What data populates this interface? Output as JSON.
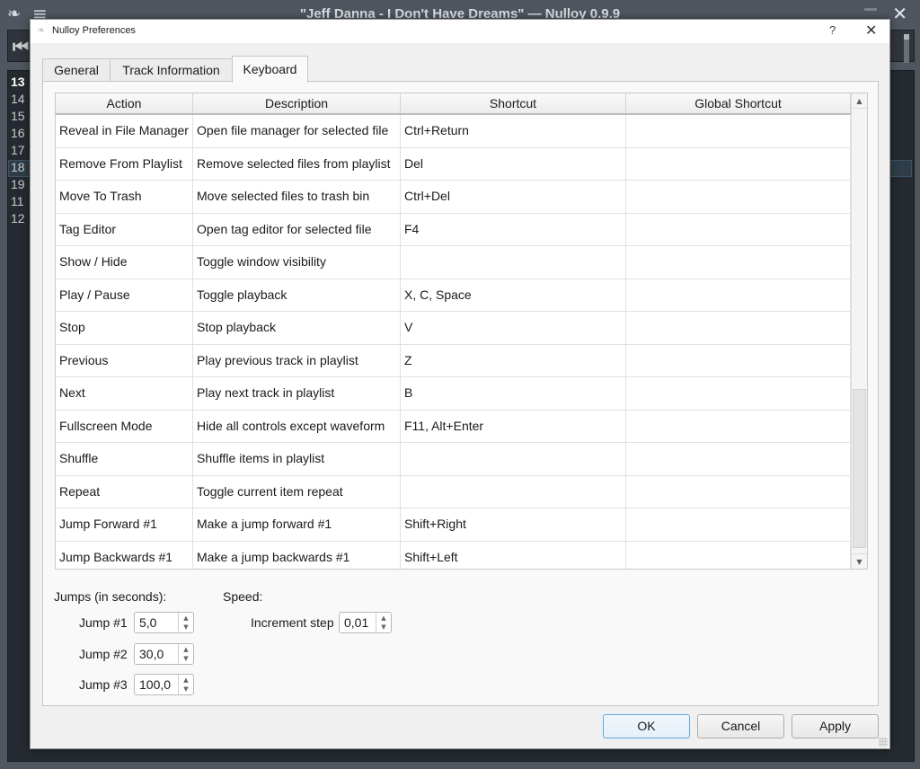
{
  "main_window": {
    "title": "\"Jeff Danna - I Don't Have Dreams\" — Nulloy 0.9.9",
    "playlist_numbers": [
      "13",
      "14",
      "15",
      "16",
      "17",
      "18",
      "19",
      "11",
      "12"
    ],
    "current_number": "13",
    "selected_number": "18"
  },
  "dialog": {
    "title": "Nulloy Preferences",
    "help_label": "?",
    "close_label": "✕",
    "tabs": [
      {
        "label": "General",
        "active": false
      },
      {
        "label": "Track Information",
        "active": false
      },
      {
        "label": "Keyboard",
        "active": true
      }
    ],
    "table": {
      "headers": [
        "Action",
        "Description",
        "Shortcut",
        "Global Shortcut"
      ],
      "rows": [
        {
          "action": "Reveal in File Manager",
          "description": "Open file manager for selected file",
          "shortcut": "Ctrl+Return",
          "global": ""
        },
        {
          "action": "Remove From Playlist",
          "description": "Remove selected files from playlist",
          "shortcut": "Del",
          "global": ""
        },
        {
          "action": "Move To Trash",
          "description": "Move selected files to trash bin",
          "shortcut": "Ctrl+Del",
          "global": ""
        },
        {
          "action": "Tag Editor",
          "description": "Open tag editor for selected file",
          "shortcut": "F4",
          "global": ""
        },
        {
          "action": "Show / Hide",
          "description": "Toggle window visibility",
          "shortcut": "",
          "global": ""
        },
        {
          "action": "Play / Pause",
          "description": "Toggle playback",
          "shortcut": "X, C, Space",
          "global": ""
        },
        {
          "action": "Stop",
          "description": "Stop playback",
          "shortcut": "V",
          "global": ""
        },
        {
          "action": "Previous",
          "description": "Play previous track in playlist",
          "shortcut": "Z",
          "global": ""
        },
        {
          "action": "Next",
          "description": "Play next track in playlist",
          "shortcut": "B",
          "global": ""
        },
        {
          "action": "Fullscreen Mode",
          "description": "Hide all controls except waveform",
          "shortcut": "F11, Alt+Enter",
          "global": ""
        },
        {
          "action": "Shuffle",
          "description": "Shuffle items in playlist",
          "shortcut": "",
          "global": ""
        },
        {
          "action": "Repeat",
          "description": "Toggle current item repeat",
          "shortcut": "",
          "global": ""
        },
        {
          "action": "Jump Forward #1",
          "description": "Make a jump forward #1",
          "shortcut": "Shift+Right",
          "global": ""
        },
        {
          "action": "Jump Backwards #1",
          "description": "Make a jump backwards #1",
          "shortcut": "Shift+Left",
          "global": ""
        }
      ],
      "scroll_position_fraction": 0.7
    },
    "jumps": {
      "heading": "Jumps (in seconds):",
      "items": [
        {
          "label": "Jump #1",
          "value": "5,0"
        },
        {
          "label": "Jump #2",
          "value": "30,0"
        },
        {
          "label": "Jump #3",
          "value": "100,0"
        }
      ]
    },
    "speed": {
      "heading": "Speed:",
      "increment_label": "Increment step",
      "increment_value": "0,01"
    },
    "buttons": {
      "ok": "OK",
      "cancel": "Cancel",
      "apply": "Apply"
    }
  }
}
